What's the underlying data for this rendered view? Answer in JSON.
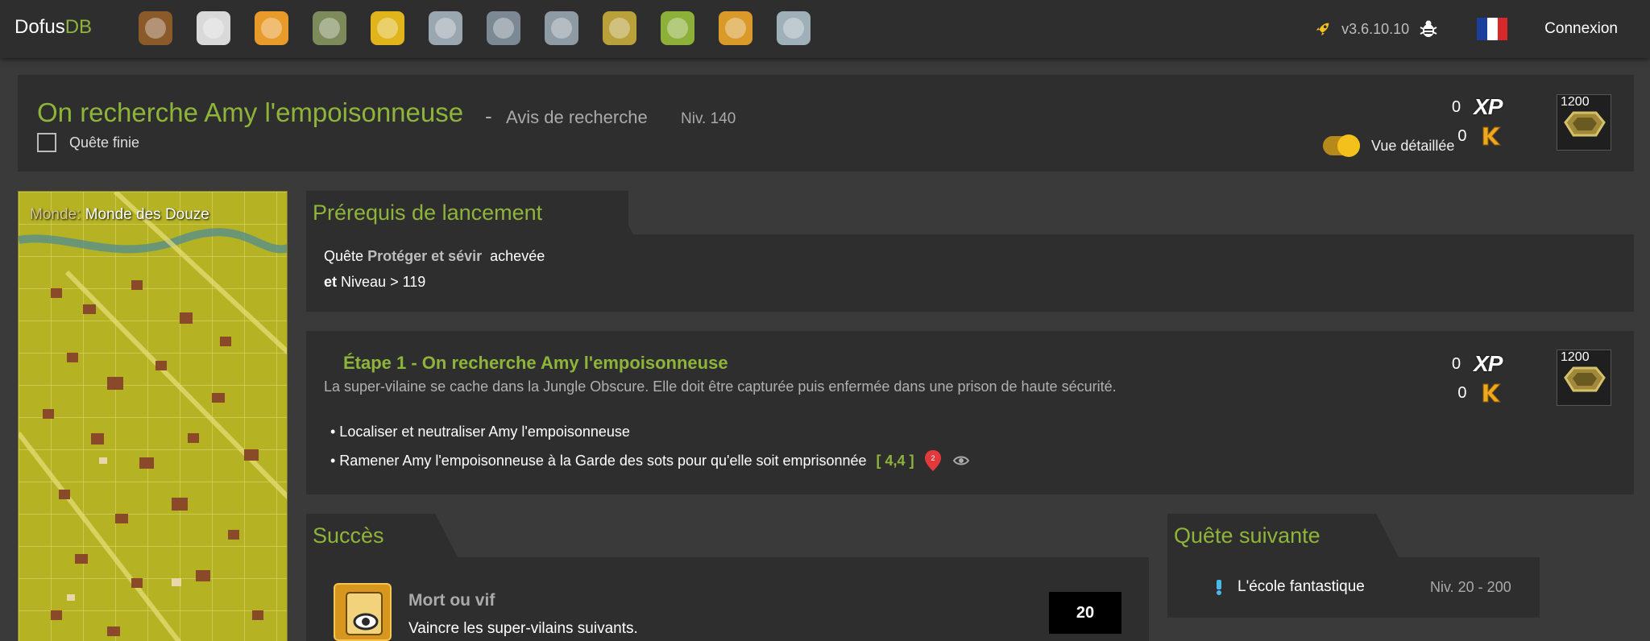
{
  "nav": {
    "brand_main": "Dofus",
    "brand_accent": "DB",
    "icons": [
      "items-icon",
      "monsters-icon",
      "classes-icon",
      "sets-icon",
      "achievements-icon",
      "quests-icon",
      "dungeons-icon",
      "almanax-icon",
      "resources-icon",
      "mounts-icon",
      "map-icon",
      "tools-icon"
    ],
    "version": "v3.6.10.10",
    "login_label": "Connexion"
  },
  "quest": {
    "title": "On recherche Amy l'empoisonneuse",
    "separator": "-",
    "category": "Avis de recherche",
    "level": "Niv. 140",
    "done_label": "Quête finie",
    "xp": "0",
    "xp_label": "XP",
    "kamas": "0",
    "reward_item_count": "1200",
    "detailed_view_label": "Vue détaillée",
    "detailed_view_on": true
  },
  "map": {
    "label_key": "Monde:",
    "label_value": "Monde des Douze"
  },
  "prereq": {
    "heading": "Prérequis de lancement",
    "line1_prefix": "Quête",
    "line1_link": "Protéger et sévir",
    "line1_suffix": "achevée",
    "line2_and": "et",
    "line2_text": "Niveau > 119"
  },
  "step": {
    "title": "Étape 1 - On recherche Amy l'empoisonneuse",
    "description": "La super-vilaine se cache dans la Jungle Obscure. Elle doit être capturée puis enfermée dans une prison de haute sécurité.",
    "objectives": [
      {
        "text": "• Localiser et neutraliser Amy l'empoisonneuse"
      },
      {
        "text": "• Ramener Amy l'empoisonneuse à la Garde des sots pour qu'elle soit emprisonnée",
        "coords": "[ 4,4 ]",
        "pin_number": "2"
      }
    ],
    "xp": "0",
    "xp_label": "XP",
    "kamas": "0",
    "reward_item_count": "1200"
  },
  "success": {
    "heading": "Succès",
    "name": "Mort ou vif",
    "description": "Vaincre les super-vilains suivants.",
    "points": "20"
  },
  "next_quest": {
    "heading": "Quête suivante",
    "name": "L'école fantastique",
    "level": "Niv. 20 - 200"
  },
  "colors": {
    "accent": "#8fb43a",
    "panel": "#2e2e2e",
    "background": "#3a3a3a",
    "toggle": "#f4c01c"
  }
}
